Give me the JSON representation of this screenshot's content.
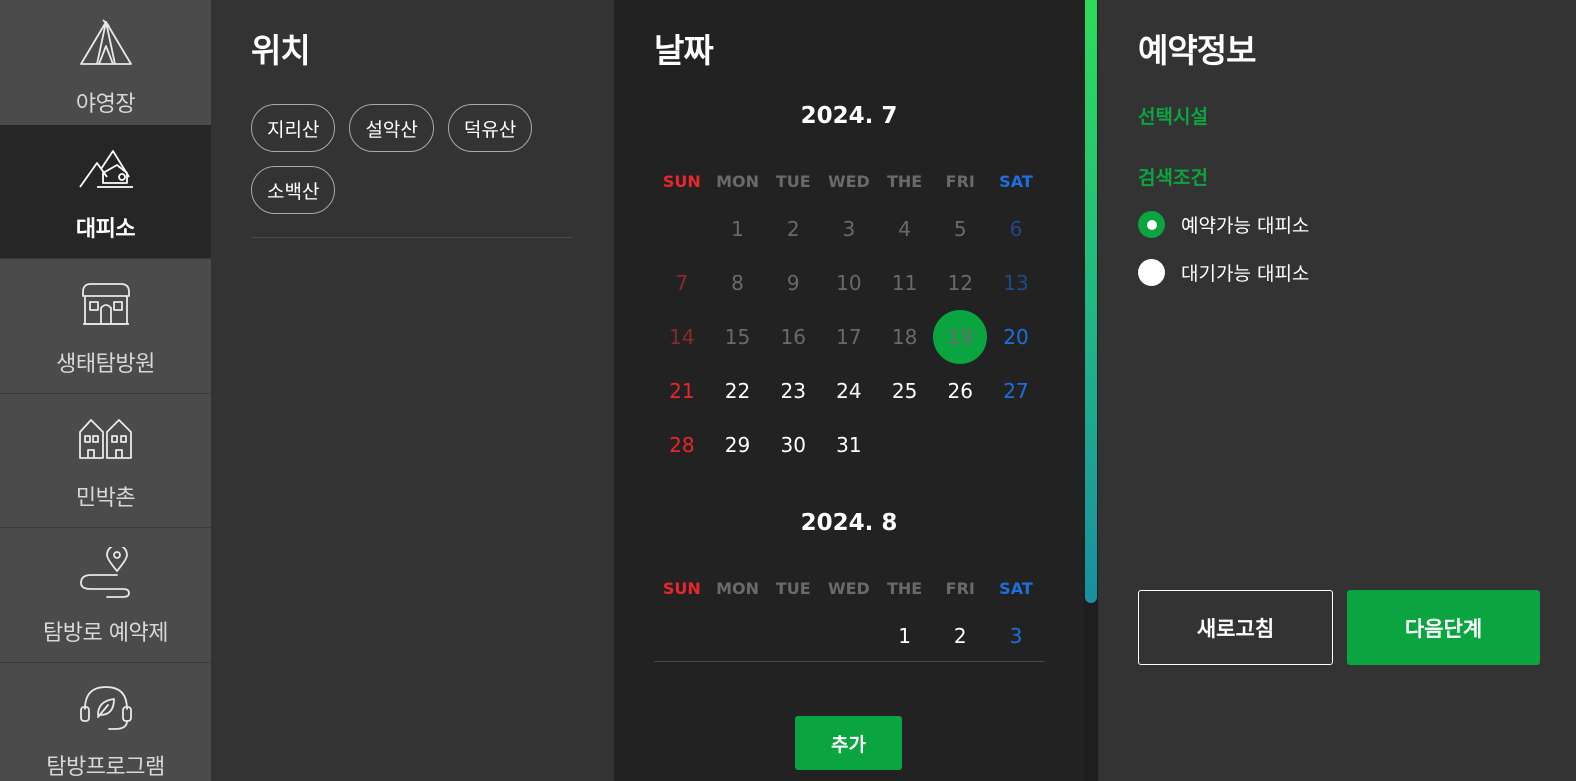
{
  "sidebar": {
    "items": [
      {
        "label": "야영장",
        "icon": "tent-icon"
      },
      {
        "label": "대피소",
        "icon": "shelter-icon"
      },
      {
        "label": "생태탐방원",
        "icon": "lodge-icon"
      },
      {
        "label": "민박촌",
        "icon": "houses-icon"
      },
      {
        "label": "탐방로 예약제",
        "icon": "trail-pin-icon"
      },
      {
        "label": "탐방프로그램",
        "icon": "headset-leaf-icon"
      }
    ],
    "active_index": 1
  },
  "location": {
    "title": "위치",
    "chips": [
      "지리산",
      "설악산",
      "덕유산",
      "소백산"
    ]
  },
  "date": {
    "title": "날짜",
    "weekdays": [
      "SUN",
      "MON",
      "TUE",
      "WED",
      "THE",
      "FRI",
      "SAT"
    ],
    "months": [
      {
        "title": "2024. 7",
        "weeks": [
          [
            "",
            "1",
            "2",
            "3",
            "4",
            "5",
            "6"
          ],
          [
            "7",
            "8",
            "9",
            "10",
            "11",
            "12",
            "13"
          ],
          [
            "14",
            "15",
            "16",
            "17",
            "18",
            "19",
            "20"
          ],
          [
            "21",
            "22",
            "23",
            "24",
            "25",
            "26",
            "27"
          ],
          [
            "28",
            "29",
            "30",
            "31",
            "",
            "",
            ""
          ]
        ],
        "today": "19"
      },
      {
        "title": "2024. 8",
        "weeks": [
          [
            "",
            "",
            "",
            "",
            "1",
            "2",
            "3"
          ]
        ]
      }
    ],
    "add_label": "추가"
  },
  "info": {
    "title": "예약정보",
    "selected_facility_label": "선택시설",
    "search_condition_label": "검색조건",
    "options": [
      {
        "label": "예약가능 대피소",
        "selected": true
      },
      {
        "label": "대기가능 대피소",
        "selected": false
      }
    ],
    "refresh_label": "새로고침",
    "next_label": "다음단계"
  },
  "colors": {
    "accent": "#0aa540",
    "sunday": "#e8262c",
    "saturday": "#1d6fe0"
  }
}
